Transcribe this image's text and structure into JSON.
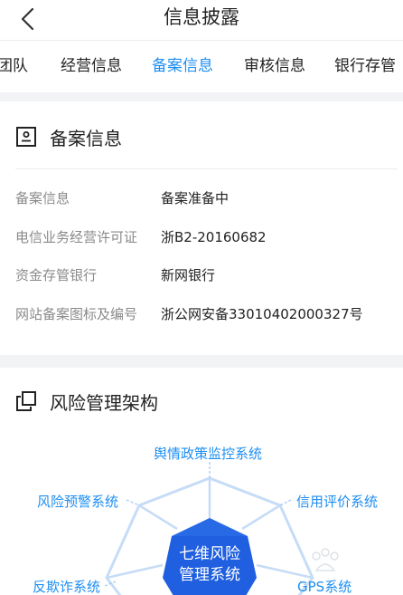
{
  "header": {
    "title": "信息披露",
    "back_icon": "chevron-left-icon"
  },
  "tabs": [
    {
      "label": "团队",
      "active": false
    },
    {
      "label": "经营信息",
      "active": false
    },
    {
      "label": "备案信息",
      "active": true
    },
    {
      "label": "审核信息",
      "active": false
    },
    {
      "label": "银行存管",
      "active": false
    }
  ],
  "filing": {
    "title": "备案信息",
    "icon": "id-card-icon",
    "rows": [
      {
        "label": "备案信息",
        "value": "备案准备中"
      },
      {
        "label": "电信业务经营许可证",
        "value": "浙B2-20160682"
      },
      {
        "label": "资金存管银行",
        "value": "新网银行"
      },
      {
        "label": "网站备案图标及编号",
        "value": "浙公网安备33010402000327号"
      }
    ]
  },
  "risk": {
    "title": "风险管理架构",
    "icon": "copy-icon",
    "center": [
      "七维风险",
      "管理系统"
    ],
    "systems": [
      "舆情政策监控系统",
      "信用评价系统",
      "GPS系统",
      "反欺诈系统",
      "风险预警系统"
    ]
  },
  "colors": {
    "accent": "#1e8ef2",
    "hex_dark": "#1f5fe0",
    "hex_mid": "#2e72ea",
    "ring_light": "#c6dcf6"
  }
}
